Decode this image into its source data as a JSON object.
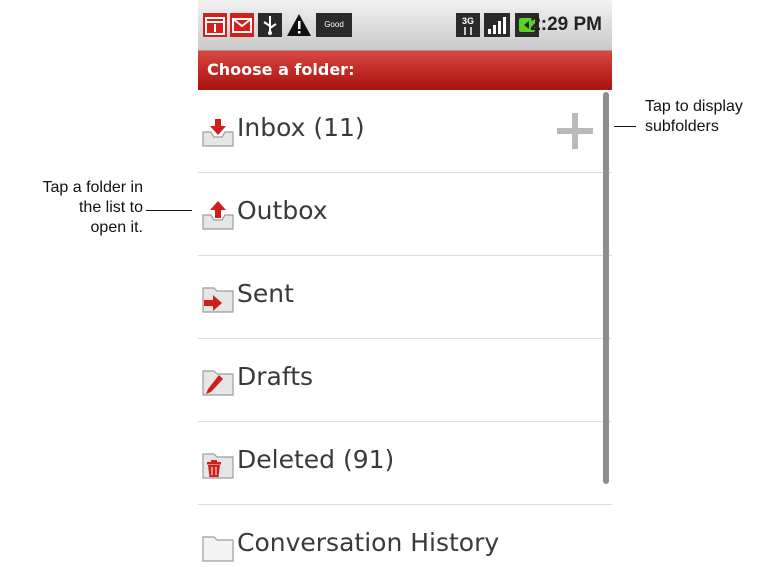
{
  "statusbar": {
    "time": "2:29 PM",
    "good_badge": "Good",
    "network_badge": "3G",
    "icons": [
      "calendar-icon",
      "mail-icon",
      "usb-icon",
      "warning-icon",
      "good-icon",
      "3g-icon",
      "signal-icon",
      "battery-icon"
    ]
  },
  "header": {
    "title": "Choose a folder:"
  },
  "folders": [
    {
      "label": "Inbox (11)",
      "icon": "inbox-icon"
    },
    {
      "label": "Outbox",
      "icon": "outbox-icon"
    },
    {
      "label": "Sent",
      "icon": "sent-icon"
    },
    {
      "label": "Drafts",
      "icon": "drafts-icon"
    },
    {
      "label": "Deleted (91)",
      "icon": "deleted-icon"
    },
    {
      "label": "Conversation History",
      "icon": "folder-icon"
    }
  ],
  "annotations": {
    "right_line1": "Tap to display",
    "right_line2": "subfolders",
    "left_line1": "Tap a folder in",
    "left_line2": "the list to",
    "left_line3": "open it."
  },
  "colors": {
    "accent_red": "#c0201b",
    "titlebar_bottom": "#a8120f",
    "statusbar": "#d9d9d9"
  }
}
